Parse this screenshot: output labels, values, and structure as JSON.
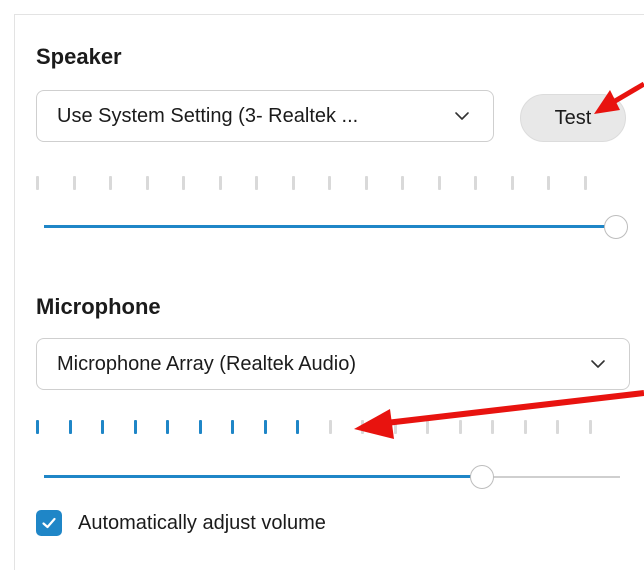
{
  "speaker": {
    "title": "Speaker",
    "device_value": "Use System Setting (3- Realtek ...",
    "test_label": "Test",
    "meter_ticks_total": 16,
    "meter_ticks_active": 0,
    "volume_fraction": 1.0
  },
  "microphone": {
    "title": "Microphone",
    "device_value": "Microphone Array (Realtek Audio)",
    "meter_ticks_total": 18,
    "meter_ticks_active": 9,
    "volume_fraction": 0.76
  },
  "auto_adjust": {
    "label": "Automatically adjust volume",
    "checked": true
  },
  "colors": {
    "accent": "#1f86c7",
    "annotation_arrow": "#e8130f"
  },
  "icons": {
    "select_chevron": "chevron-down-icon",
    "checkbox_mark": "checkmark-icon",
    "annotation": "arrow-icon"
  }
}
